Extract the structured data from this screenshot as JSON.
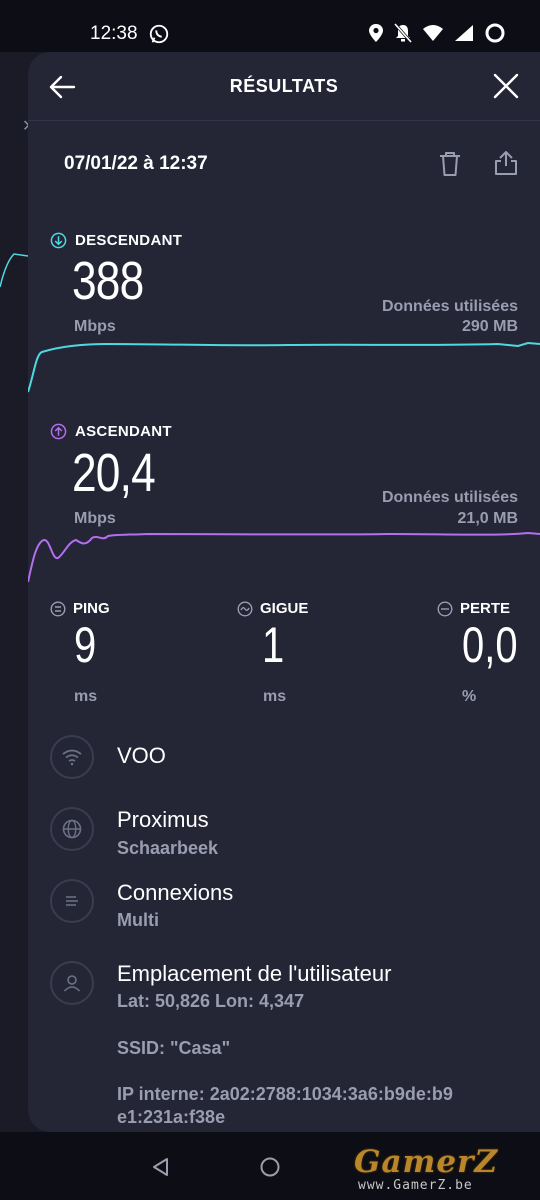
{
  "status_bar": {
    "time": "12:38"
  },
  "header": {
    "title": "RÉSULTATS"
  },
  "result": {
    "datetime": "07/01/22 à 12:37"
  },
  "download": {
    "label": "DESCENDANT",
    "value": "388",
    "unit": "Mbps",
    "data_used_label": "Données utilisées",
    "data_used_value": "290 MB",
    "color": "#4fd8e0"
  },
  "upload": {
    "label": "ASCENDANT",
    "value": "20,4",
    "unit": "Mbps",
    "data_used_label": "Données utilisées",
    "data_used_value": "21,0 MB",
    "color": "#b46ef0"
  },
  "ping": {
    "label": "PING",
    "value": "9",
    "unit": "ms"
  },
  "jitter": {
    "label": "GIGUE",
    "value": "1",
    "unit": "ms"
  },
  "loss": {
    "label": "PERTE",
    "value": "0,0",
    "unit": "%"
  },
  "details": {
    "wifi": {
      "title": "VOO"
    },
    "server": {
      "title": "Proximus",
      "subtitle": "Schaarbeek"
    },
    "connections": {
      "title": "Connexions",
      "subtitle": "Multi"
    },
    "location": {
      "title": "Emplacement de l'utilisateur",
      "coords": "Lat: 50,826 Lon: 4,347",
      "ssid": "SSID: \"Casa\"",
      "ip_line1": "IP interne: 2a02:2788:1034:3a6:b9de:b9",
      "ip_line2": "e1:231a:f38e"
    }
  },
  "watermark": {
    "logo": "GamerZ",
    "url": "www.GamerZ.be"
  },
  "icons": [
    "whatsapp-icon",
    "location-icon",
    "bell-off-icon",
    "wifi-icon",
    "signal-icon",
    "battery-icon",
    "back-arrow-icon",
    "close-icon",
    "trash-icon",
    "share-icon",
    "download-icon",
    "upload-icon",
    "ping-icon",
    "jitter-icon",
    "loss-icon",
    "globe-icon",
    "connections-icon",
    "user-icon",
    "nav-back-icon",
    "nav-home-icon"
  ]
}
